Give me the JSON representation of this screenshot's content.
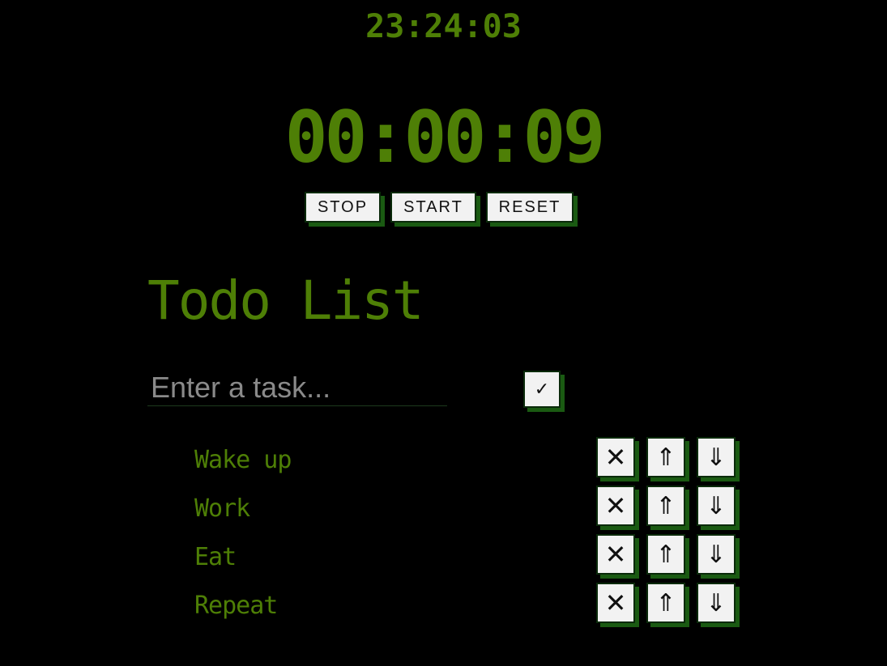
{
  "clock": {
    "time": "23:24:03"
  },
  "stopwatch": {
    "elapsed": "00:00:09"
  },
  "controls": {
    "stop_label": "STOP",
    "start_label": "START",
    "reset_label": "RESET"
  },
  "todo": {
    "title": "Todo List",
    "input_placeholder": "Enter a task...",
    "input_value": "",
    "add_button_label": "✓",
    "delete_icon": "✕",
    "move_up_icon": "⇑",
    "move_down_icon": "⇓",
    "items": [
      {
        "text": "Wake up"
      },
      {
        "text": "Work"
      },
      {
        "text": "Eat"
      },
      {
        "text": "Repeat"
      }
    ]
  },
  "colors": {
    "background": "#000000",
    "accent_green": "#4e7f06",
    "button_shadow": "#1a5a12",
    "button_face": "#f2f2f2"
  }
}
